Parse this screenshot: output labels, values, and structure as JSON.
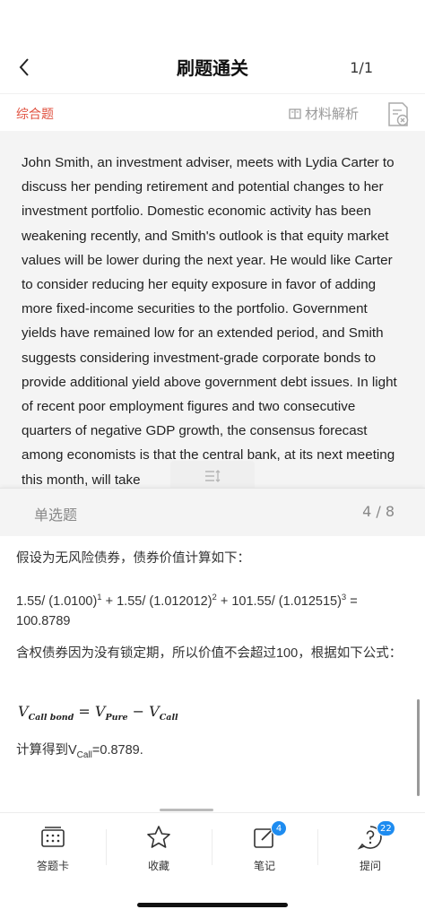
{
  "nav": {
    "title": "刷题通关",
    "counter": "1/1"
  },
  "subbar": {
    "question_type": "综合题",
    "analysis_label": "材料解析"
  },
  "passage": "John Smith, an investment adviser, meets with Lydia Carter to discuss her pending retirement and potential changes to her investment portfolio. Domestic economic activity has been weakening recently, and Smith's outlook is that equity market values will be lower during the next year. He would like Carter to consider reducing her equity exposure in favor of adding more fixed-income securities to the portfolio. Government yields have remained low for an extended period, and Smith suggests considering investment-grade corporate bonds to provide additional yield above government debt issues. In light of recent poor employment figures and two consecutive quarters of negative GDP growth, the consensus forecast among economists is that the central bank, at its next meeting this month, will take",
  "question_bar": {
    "type": "单选题",
    "count": "4 / 8"
  },
  "answer": {
    "line1": "假设为无风险债券，债券价值计算如下：",
    "calc_a": "1.55/ (1.0100)",
    "calc_a_exp": "1",
    "calc_b": " + 1.55/ (1.012012)",
    "calc_b_exp": "2",
    "calc_c": " + 101.55/ (1.012515)",
    "calc_c_exp": "3",
    "calc_d": " = 100.8789",
    "line3": "含权债券因为没有锁定期，所以价值不会超过100，根据如下公式：",
    "formula_v": "V",
    "formula_sub1": "Call bond",
    "formula_eq": " = V",
    "formula_sub2": "Pure",
    "formula_minus": " − V",
    "formula_sub3": "Call",
    "result_pre": "计算得到V",
    "result_sub": "Call",
    "result_post": "=0.8789."
  },
  "tabbar": {
    "tabs": [
      {
        "label": "答题卡",
        "icon": "answer-card-icon"
      },
      {
        "label": "收藏",
        "icon": "star-icon"
      },
      {
        "label": "笔记",
        "icon": "note-icon",
        "badge": "4"
      },
      {
        "label": "提问",
        "icon": "question-icon",
        "badge": "22"
      }
    ]
  },
  "colors": {
    "accent_red": "#e0513f",
    "badge_blue": "#1e8cf0",
    "muted": "#888888"
  }
}
